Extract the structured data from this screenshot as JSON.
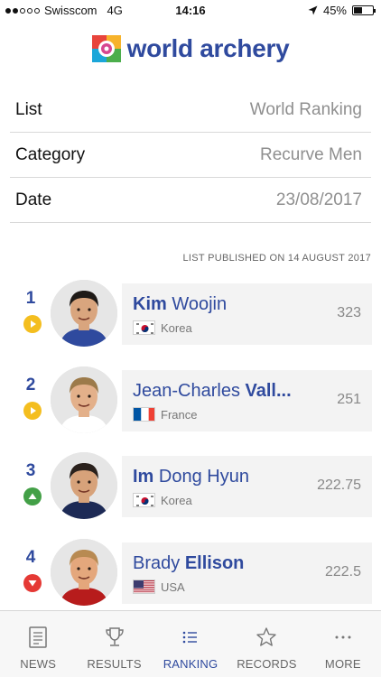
{
  "status_bar": {
    "carrier": "Swisscom",
    "network": "4G",
    "time": "14:16",
    "battery": "45%",
    "battery_level": 0.45,
    "signal_bars": 2
  },
  "logo": {
    "text": "world archery"
  },
  "filters": [
    {
      "label": "List",
      "value": "World Ranking"
    },
    {
      "label": "Category",
      "value": "Recurve Men"
    },
    {
      "label": "Date",
      "value": "23/08/2017"
    }
  ],
  "published": "LIST PUBLISHED ON 14 AUGUST 2017",
  "rankings": [
    {
      "rank": "1",
      "trend": "same",
      "first": "Kim",
      "second": " Woojin",
      "country": "Korea",
      "points": "323",
      "bold": "first",
      "flag": "korea"
    },
    {
      "rank": "2",
      "trend": "same",
      "first": "Jean-Charles ",
      "second": "Vall...",
      "country": "France",
      "points": "251",
      "bold": "second",
      "flag": "france"
    },
    {
      "rank": "3",
      "trend": "up",
      "first": "Im",
      "second": " Dong Hyun",
      "country": "Korea",
      "points": "222.75",
      "bold": "first",
      "flag": "korea"
    },
    {
      "rank": "4",
      "trend": "down",
      "first": "Brady ",
      "second": "Ellison",
      "country": "USA",
      "points": "222.5",
      "bold": "second",
      "flag": "usa"
    }
  ],
  "tabs": [
    {
      "label": "NEWS",
      "icon": "news-icon",
      "active": false
    },
    {
      "label": "RESULTS",
      "icon": "trophy-icon",
      "active": false
    },
    {
      "label": "RANKING",
      "icon": "list-icon",
      "active": true
    },
    {
      "label": "RECORDS",
      "icon": "star-icon",
      "active": false
    },
    {
      "label": "MORE",
      "icon": "more-icon",
      "active": false
    }
  ],
  "colors": {
    "brand_blue": "#2f4a9e",
    "trend_same": "#f4be1f",
    "trend_up": "#43a047",
    "trend_down": "#e53935"
  }
}
